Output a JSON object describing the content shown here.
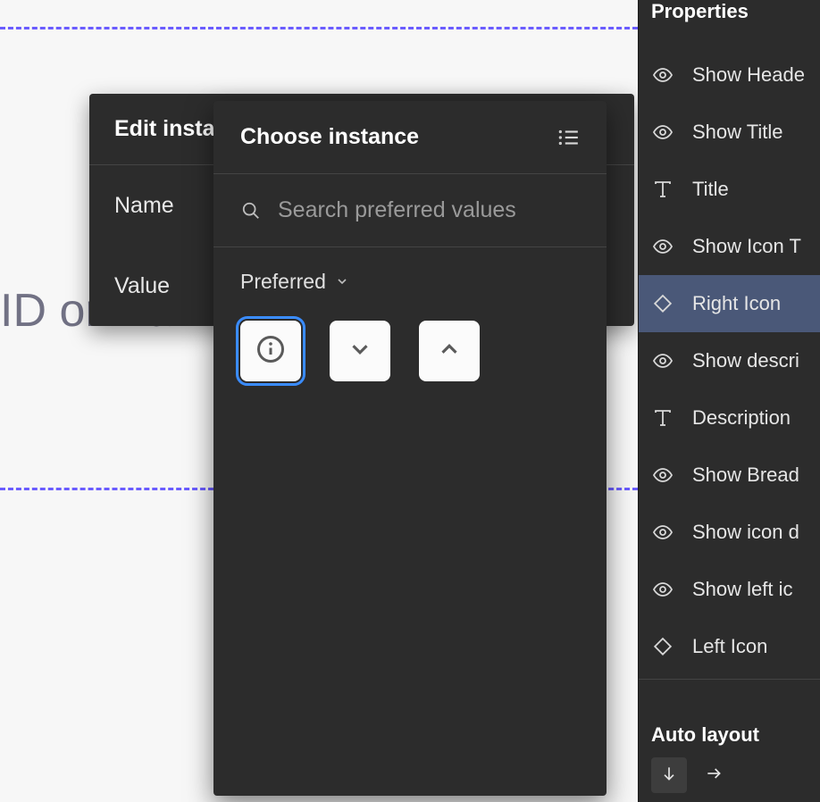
{
  "canvas": {
    "placeholder_text": "ID or Na"
  },
  "edit_panel": {
    "title": "Edit instan",
    "rows": {
      "name": "Name",
      "value": "Value"
    }
  },
  "choose_panel": {
    "title": "Choose instance",
    "search_placeholder": "Search preferred values",
    "preferred_label": "Preferred",
    "icon_options": {
      "info": "info-icon",
      "chevron_down": "chevron-down-icon",
      "chevron_up": "chevron-up-icon"
    }
  },
  "properties": {
    "title": "Properties",
    "items": [
      {
        "label": "Show Heade",
        "type": "visibility",
        "selected": false
      },
      {
        "label": "Show Title",
        "type": "visibility",
        "selected": false
      },
      {
        "label": "Title",
        "type": "text",
        "selected": false
      },
      {
        "label": "Show Icon T",
        "type": "visibility",
        "selected": false
      },
      {
        "label": "Right Icon",
        "type": "instance",
        "selected": true
      },
      {
        "label": "Show descri",
        "type": "visibility",
        "selected": false
      },
      {
        "label": "Description",
        "type": "text",
        "selected": false
      },
      {
        "label": "Show Bread",
        "type": "visibility",
        "selected": false
      },
      {
        "label": "Show icon d",
        "type": "visibility",
        "selected": false
      },
      {
        "label": "Show left ic",
        "type": "visibility",
        "selected": false
      },
      {
        "label": "Left Icon",
        "type": "instance",
        "selected": false
      }
    ],
    "auto_layout_title": "Auto layout"
  }
}
